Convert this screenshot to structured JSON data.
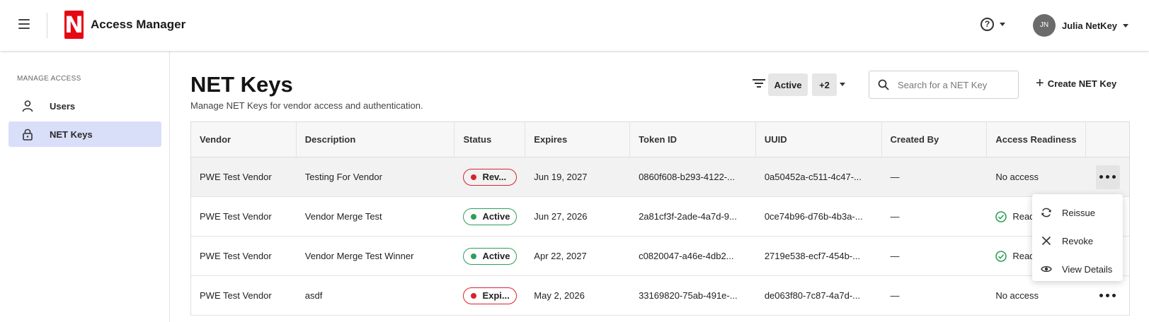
{
  "header": {
    "app_title": "Access Manager",
    "logo_letter": "N",
    "help_icon_text": "?",
    "user": {
      "initials": "JN",
      "name": "Julia NetKey"
    }
  },
  "sidebar": {
    "caption": "MANAGE ACCESS",
    "items": [
      {
        "label": "Users",
        "icon": "person-icon"
      },
      {
        "label": "NET Keys",
        "icon": "lock-icon",
        "active": true
      }
    ]
  },
  "page": {
    "title": "NET Keys",
    "subtitle": "Manage NET Keys for vendor access and authentication."
  },
  "toolbar": {
    "filter_chip": "Active",
    "more_filters_chip": "+2",
    "search_placeholder": "Search for a NET Key",
    "create_plus": "+",
    "create_label": "Create NET Key"
  },
  "table": {
    "columns": [
      "Vendor",
      "Description",
      "Status",
      "Expires",
      "Token ID",
      "UUID",
      "Created By",
      "Access Readiness"
    ],
    "rows": [
      {
        "vendor": "PWE Test Vendor",
        "description": "Testing For Vendor",
        "status": "Rev...",
        "status_color": "#d6242f",
        "expires": "Jun 19, 2027",
        "token_id": "0860f608-b293-4122-...",
        "uuid": "0a50452a-c511-4c47-...",
        "created_by": "—",
        "readiness": "No access"
      },
      {
        "vendor": "PWE Test Vendor",
        "description": "Vendor Merge Test",
        "status": "Active",
        "status_color": "#2e9e58",
        "expires": "Jun 27, 2026",
        "token_id": "2a81cf3f-2ade-4a7d-9...",
        "uuid": "0ce74b96-d76b-4b3a-...",
        "created_by": "—",
        "readiness": "Read"
      },
      {
        "vendor": "PWE Test Vendor",
        "description": "Vendor Merge Test Winner",
        "status": "Active",
        "status_color": "#2e9e58",
        "expires": "Apr 22, 2027",
        "token_id": "c0820047-a46e-4db2...",
        "uuid": "2719e538-ecf7-454b-...",
        "created_by": "—",
        "readiness": "Read"
      },
      {
        "vendor": "PWE Test Vendor",
        "description": "asdf",
        "status": "Expi...",
        "status_color": "#d6242f",
        "expires": "May 2, 2026",
        "token_id": "33169820-75ab-491e-...",
        "uuid": "de063f80-7c87-4a7d-...",
        "created_by": "—",
        "readiness": "No access"
      }
    ]
  },
  "row_menu": {
    "items": [
      {
        "label": "Reissue",
        "icon": "refresh-icon"
      },
      {
        "label": "Revoke",
        "icon": "close-icon"
      },
      {
        "label": "View Details",
        "icon": "eye-icon"
      }
    ]
  }
}
